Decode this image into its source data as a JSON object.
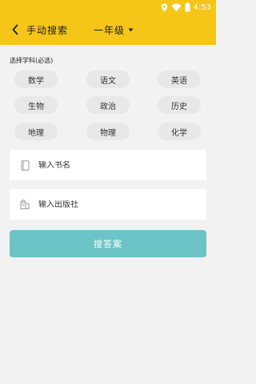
{
  "status_bar": {
    "time": "4:53",
    "icons": [
      "location-icon",
      "wifi-icon",
      "battery-icon"
    ]
  },
  "header": {
    "back_icon": "chevron-left-icon",
    "title": "手动搜索",
    "grade": "一年级",
    "grade_dropdown_icon": "caret-down-icon"
  },
  "subjects": {
    "label": "选择学科(必选)",
    "items": [
      {
        "label": "数学"
      },
      {
        "label": "语文"
      },
      {
        "label": "英语"
      },
      {
        "label": "生物"
      },
      {
        "label": "政治"
      },
      {
        "label": "历史"
      },
      {
        "label": "地理"
      },
      {
        "label": "物理"
      },
      {
        "label": "化学"
      }
    ]
  },
  "form": {
    "book_name_placeholder": "输入书名",
    "publisher_placeholder": "输入出版社",
    "book_icon": "book-icon",
    "publisher_icon": "building-icon"
  },
  "search_button": {
    "label": "搜答案"
  },
  "colors": {
    "accent": "#f5c518",
    "button": "#6cc4c6",
    "background": "#f2f2f2",
    "chip": "#e8e8e8"
  }
}
